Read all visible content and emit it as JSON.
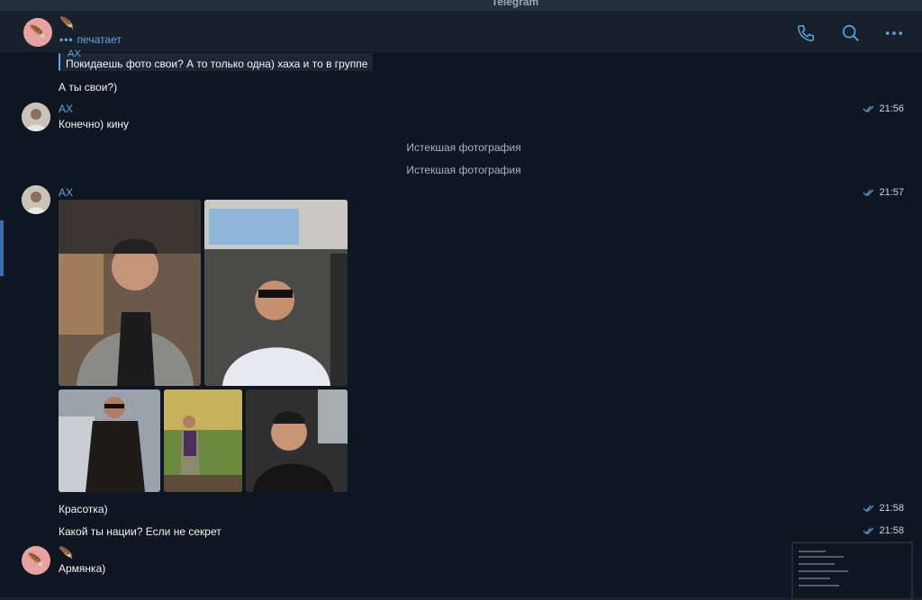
{
  "window": {
    "title": "Telegram"
  },
  "header": {
    "contact_name": "🪶",
    "status_dots": "•••",
    "status_text": "печатает"
  },
  "messages": {
    "reply_quote_name": "АХ",
    "reply_quote_text": "Покидаешь фото свои? А то только одна) хаха и то в группе",
    "reply_text": "А ты свои?)",
    "ax_name": "АХ",
    "msg_kino": "Конечно) кину",
    "msg_kino_time": "21:56",
    "expired_1": "Истекшая фотография",
    "expired_2": "Истекшая фотография",
    "album_sender": "АХ",
    "album_time": "21:57",
    "msg_krasotka": "Красотка)",
    "msg_krasotka_time": "21:58",
    "msg_nation": "Какой ты нации? Если не секрет",
    "msg_nation_time": "21:58",
    "contact_name_2": "🪶",
    "msg_armyanka": "Армянка)"
  },
  "colors": {
    "accent": "#5ea5e6",
    "background": "#0e1621",
    "header": "#17212b"
  },
  "icons": {
    "call": "phone-icon",
    "search": "search-icon",
    "more": "more-icon",
    "read": "double-check-icon"
  }
}
